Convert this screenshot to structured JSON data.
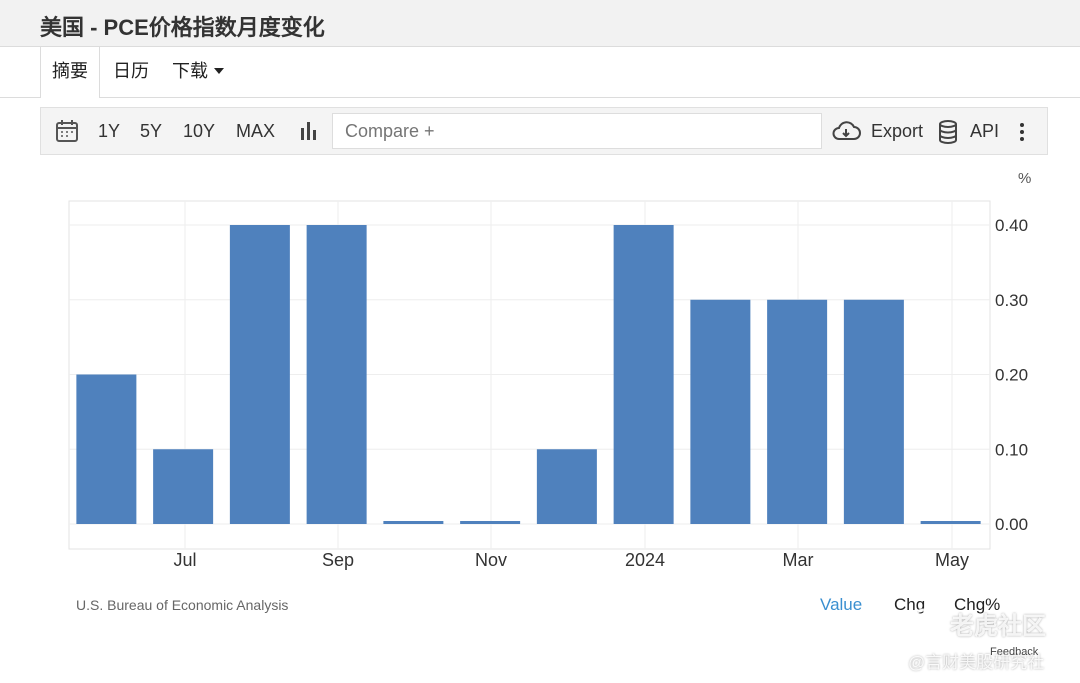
{
  "title": "美国 - PCE价格指数月度变化",
  "tabs": [
    {
      "label": "摘要",
      "active": true
    },
    {
      "label": "日历",
      "active": false
    },
    {
      "label": "下载",
      "active": false
    }
  ],
  "toolbar": {
    "calendar_icon": "calendar-icon",
    "ranges": [
      "1Y",
      "5Y",
      "10Y",
      "MAX"
    ],
    "chart_type_icon": "bar-chart-icon",
    "compare_placeholder": "Compare +",
    "export_label": "Export",
    "export_icon": "cloud-download-icon",
    "api_label": "API",
    "api_icon": "database-icon",
    "more_icon": "vertical-ellipsis-icon"
  },
  "chart_data": {
    "type": "bar",
    "unit": "%",
    "x_tick_labels": [
      "Jul",
      "Sep",
      "Nov",
      "2024",
      "Mar",
      "May"
    ],
    "values": [
      0.2,
      0.1,
      0.4,
      0.4,
      0.003,
      0.003,
      0.1,
      0.4,
      0.3,
      0.3,
      0.3,
      0.003
    ],
    "y_ticks": [
      "0.40",
      "0.30",
      "0.20",
      "0.10",
      "0.00"
    ],
    "ylim": [
      0,
      0.4
    ],
    "bar_color": "#4f81bd",
    "grid": true
  },
  "footer": {
    "source": "U.S. Bureau of Economic Analysis",
    "value_label": "Value",
    "chg_label": "Chg",
    "chg_pct_label": "Chg%",
    "feedback_label": "Feedback",
    "link_color": "#3a8fd0"
  },
  "watermark": {
    "brand": "老虎社区",
    "handle": "@言财美股研究社"
  }
}
